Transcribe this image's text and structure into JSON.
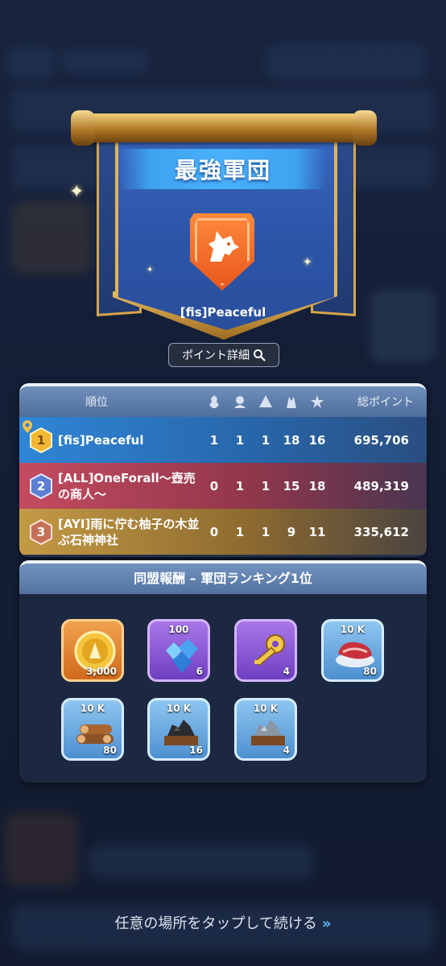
{
  "banner": {
    "title": "最強軍団",
    "guild_name": "[fis]Peaceful",
    "emblem_icon": "wolf-head-icon",
    "emblem_color": "#f06a2a",
    "detail_button": "ポイント詳細"
  },
  "ranking": {
    "header": {
      "rank_label": "順位",
      "stat_icons": [
        "stat-icon-1",
        "stat-icon-2",
        "stat-icon-3",
        "stat-icon-4",
        "stat-icon-5"
      ],
      "total_label": "総ポイント"
    },
    "rows": [
      {
        "rank": "1",
        "name": "[fis]Peaceful",
        "stats": [
          "1",
          "1",
          "1",
          "18",
          "16"
        ],
        "total": "695,706"
      },
      {
        "rank": "2",
        "name": "[ALL]OneForall～壺売の商人～",
        "stats": [
          "0",
          "1",
          "1",
          "15",
          "18"
        ],
        "total": "489,319"
      },
      {
        "rank": "3",
        "name": "[AYI]雨に佇む柚子の木並ぶ石神神社",
        "stats": [
          "0",
          "1",
          "1",
          "9",
          "11"
        ],
        "total": "335,612"
      }
    ]
  },
  "rewards": {
    "title": "同盟報酬 – 軍団ランキング1位",
    "items": [
      {
        "icon": "gold-coin-icon",
        "top": "",
        "qty": "3,000"
      },
      {
        "icon": "blue-gems-icon",
        "top": "100",
        "qty": "6"
      },
      {
        "icon": "gold-key-icon",
        "top": "",
        "qty": "4"
      },
      {
        "icon": "meat-icon",
        "top": "10 K",
        "qty": "80"
      },
      {
        "icon": "wood-logs-icon",
        "top": "10 K",
        "qty": "80"
      },
      {
        "icon": "coal-ore-icon",
        "top": "10 K",
        "qty": "16"
      },
      {
        "icon": "iron-ore-icon",
        "top": "10 K",
        "qty": "4"
      }
    ]
  },
  "footer": {
    "continue_text": "任意の場所をタップして続ける",
    "continue_arrow": "»"
  }
}
